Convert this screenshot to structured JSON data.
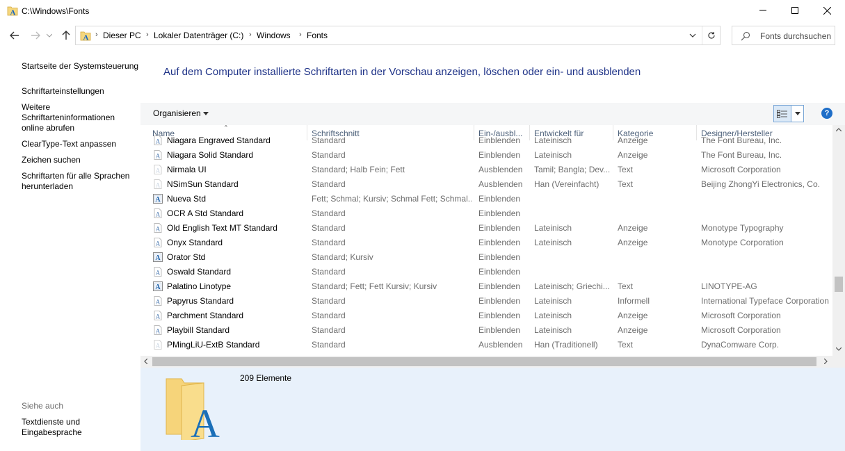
{
  "window": {
    "title": "C:\\Windows\\Fonts"
  },
  "address": {
    "crumbs": [
      "Dieser PC",
      "Lokaler Datenträger (C:)",
      "Windows",
      "Fonts"
    ]
  },
  "search": {
    "placeholder": "Fonts durchsuchen"
  },
  "sidebar": {
    "links": [
      "Startseite der Systemsteuerung",
      "Schriftarteinstellungen",
      "Weitere Schriftarteninformationen online abrufen",
      "ClearType-Text anpassen",
      "Zeichen suchen",
      "Schriftarten für alle Sprachen herunterladen"
    ],
    "see_also_label": "Siehe auch",
    "see_also_links": [
      "Textdienste und Eingabesprache"
    ]
  },
  "main": {
    "heading": "Auf dem Computer installierte Schriftarten in der Vorschau anzeigen, löschen oder ein- und ausblenden",
    "toolbar": {
      "organise_label": "Organisieren",
      "help_label": "?"
    },
    "columns": [
      "Name",
      "Schriftschnitt",
      "Ein-/ausbl...",
      "Entwickelt für",
      "Kategorie",
      "Designer/Hersteller"
    ],
    "rows": [
      {
        "name": "Niagara Engraved Standard",
        "style": "Standard",
        "visibility": "Einblenden",
        "script": "Lateinisch",
        "category": "Anzeige",
        "designer": "The Font Bureau, Inc.",
        "icon": "font-file-icon"
      },
      {
        "name": "Niagara Solid Standard",
        "style": "Standard",
        "visibility": "Einblenden",
        "script": "Lateinisch",
        "category": "Anzeige",
        "designer": "The Font Bureau, Inc.",
        "icon": "font-file-icon"
      },
      {
        "name": "Nirmala UI",
        "style": "Standard; Halb Fein; Fett",
        "visibility": "Ausblenden",
        "script": "Tamil; Bangla; Dev...",
        "category": "Text",
        "designer": "Microsoft Corporation",
        "icon": "font-file-faded-icon"
      },
      {
        "name": "NSimSun Standard",
        "style": "Standard",
        "visibility": "Ausblenden",
        "script": "Han (Vereinfacht)",
        "category": "Text",
        "designer": "Beijing ZhongYi Electronics, Co.",
        "icon": "font-file-faded-icon"
      },
      {
        "name": "Nueva Std",
        "style": "Fett; Schmal; Kursiv; Schmal Fett; Schmal...",
        "visibility": "Einblenden",
        "script": "",
        "category": "",
        "designer": "",
        "icon": "font-family-icon"
      },
      {
        "name": "OCR A Std Standard",
        "style": "Standard",
        "visibility": "Einblenden",
        "script": "",
        "category": "",
        "designer": "",
        "icon": "font-file-icon"
      },
      {
        "name": "Old English Text MT Standard",
        "style": "Standard",
        "visibility": "Einblenden",
        "script": "Lateinisch",
        "category": "Anzeige",
        "designer": "Monotype Typography",
        "icon": "font-file-icon"
      },
      {
        "name": "Onyx Standard",
        "style": "Standard",
        "visibility": "Einblenden",
        "script": "Lateinisch",
        "category": "Anzeige",
        "designer": "Monotype Corporation",
        "icon": "font-file-icon"
      },
      {
        "name": "Orator Std",
        "style": "Standard; Kursiv",
        "visibility": "Einblenden",
        "script": "",
        "category": "",
        "designer": "",
        "icon": "font-family-icon"
      },
      {
        "name": "Oswald Standard",
        "style": "Standard",
        "visibility": "Einblenden",
        "script": "",
        "category": "",
        "designer": "",
        "icon": "font-file-icon"
      },
      {
        "name": "Palatino Linotype",
        "style": "Standard; Fett; Fett Kursiv; Kursiv",
        "visibility": "Einblenden",
        "script": "Lateinisch; Griechi...",
        "category": "Text",
        "designer": "LINOTYPE-AG",
        "icon": "font-family-icon"
      },
      {
        "name": "Papyrus Standard",
        "style": "Standard",
        "visibility": "Einblenden",
        "script": "Lateinisch",
        "category": "Informell",
        "designer": "International Typeface Corporation",
        "icon": "font-file-icon"
      },
      {
        "name": "Parchment Standard",
        "style": "Standard",
        "visibility": "Einblenden",
        "script": "Lateinisch",
        "category": "Anzeige",
        "designer": "Microsoft Corporation",
        "icon": "font-file-icon"
      },
      {
        "name": "Playbill Standard",
        "style": "Standard",
        "visibility": "Einblenden",
        "script": "Lateinisch",
        "category": "Anzeige",
        "designer": "Microsoft Corporation",
        "icon": "font-file-icon"
      },
      {
        "name": "PMingLiU-ExtB Standard",
        "style": "Standard",
        "visibility": "Ausblenden",
        "script": "Han (Traditionell)",
        "category": "Text",
        "designer": "DynaComware Corp.",
        "icon": "font-file-faded-icon"
      }
    ]
  },
  "details": {
    "count_text": "209 Elemente"
  },
  "colors": {
    "heading": "#1e3287",
    "details_bg": "#e8f1fb",
    "help_blue": "#1e6ec8"
  }
}
